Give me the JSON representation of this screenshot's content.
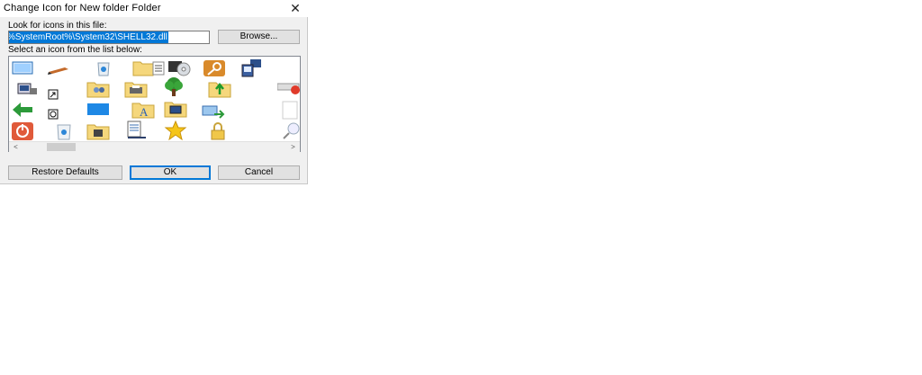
{
  "dialog": {
    "title": "Change Icon for New folder Folder",
    "close_glyph": "✕",
    "file_label": "Look for icons in this file:",
    "file_value": "%SystemRoot%\\System32\\SHELL32.dll",
    "browse_label": "Browse...",
    "list_label": "Select an icon from the list below:",
    "restore_label": "Restore Defaults",
    "ok_label": "OK",
    "cancel_label": "Cancel",
    "scroll_left": "<",
    "scroll_right": ">"
  },
  "icons": [
    "monitor-window-icon",
    "pen-icon",
    "recycle-bin-icon",
    "folder-blank-icon",
    "folder-list-icon",
    "cd-drive-icon",
    "key-icon",
    "network-computers-icon",
    "computer-printer-icon",
    "shortcut-arrow-icon",
    "folder-users-icon",
    "folder-printer-icon",
    "tree-icon",
    "folder-up-icon",
    "remove-drive-icon",
    "back-arrow-icon",
    "sync-small-icon",
    "blue-rectangle-icon",
    "folder-font-icon",
    "folder-computer-icon",
    "network-arrows-icon",
    "blank-page-icon",
    "power-icon",
    "recycle-bin-empty-icon",
    "folder-tools-icon",
    "document-list-icon",
    "star-icon",
    "lock-icon",
    "search-icon"
  ]
}
